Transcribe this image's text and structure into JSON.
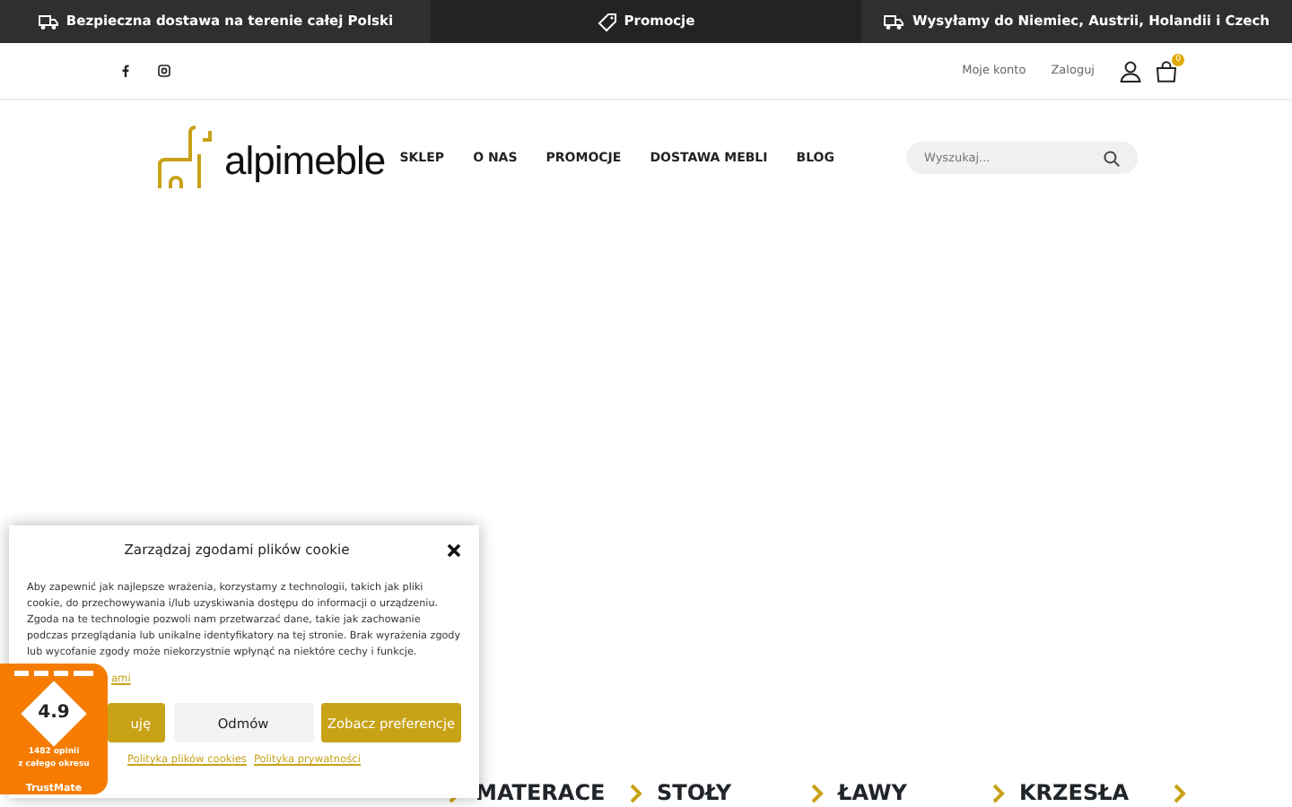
{
  "top_bar": [
    {
      "text": "Bezpieczna dostawa na terenie całej Polski"
    },
    {
      "text": "Promocje"
    },
    {
      "text": "Wysyłamy do Niemiec, Austrii, Holandii i Czech"
    }
  ],
  "account_links": [
    "Moje konto",
    "Zaloguj"
  ],
  "cart": {
    "count": "0"
  },
  "logo": {
    "text": "alpimeble"
  },
  "nav": [
    "SKLEP",
    "O NAS",
    "PROMOCJE",
    "DOSTAWA MEBLI",
    "BLOG"
  ],
  "search": {
    "placeholder": "Wyszukaj..."
  },
  "categories": [
    "MATERACE",
    "STOŁY",
    "ŁAWY",
    "KRZESŁA"
  ],
  "cookie_dialog": {
    "title": "Zarządzaj zgodami plików cookie",
    "body": "Aby zapewnić jak najlepsze wrażenia, korzystamy z technologii, takich jak pliki cookie, do przechowywania i/lub uzyskiwania dostępu do informacji o urządzeniu. Zgoda na te technologie pozwoli nam przetwarzać dane, takie jak zachowanie podczas przeglądania lub unikalne identyfikatory na tej stronie. Brak wyrażenia zgody lub wycofanie zgody może niekorzystnie wpłynąć na niektóre cechy i funkcje.",
    "manage_link": "ami",
    "buttons": [
      {
        "label": "uję",
        "kind": "accept"
      },
      {
        "label": "Odmów",
        "kind": "deny"
      },
      {
        "label": "Zobacz preferencje",
        "kind": "prefs"
      }
    ],
    "links": [
      "Polityka plików cookies",
      "Polityka prywatności"
    ]
  },
  "rating_badge": {
    "score": "4.9",
    "reviews": "1482 opinii",
    "period": "z całego okresu",
    "brand": "TrustMate"
  }
}
